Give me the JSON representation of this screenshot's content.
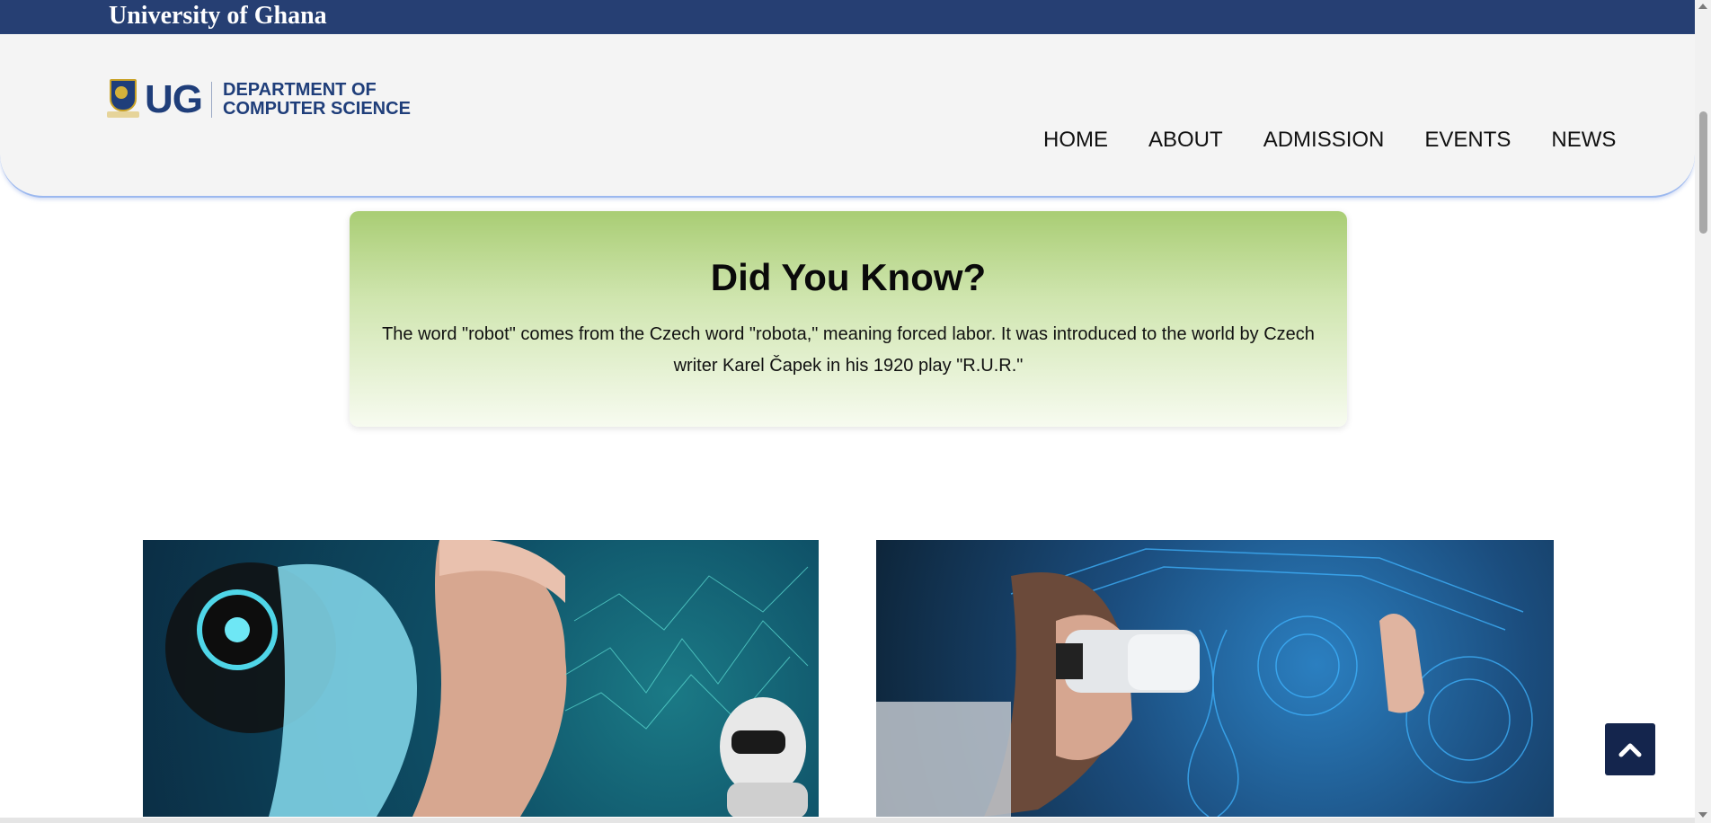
{
  "topbar": {
    "title": "University of Ghana"
  },
  "logo": {
    "short": "UG",
    "dept_line1": "DEPARTMENT OF",
    "dept_line2": "COMPUTER SCIENCE"
  },
  "nav": {
    "items": [
      {
        "label": "HOME"
      },
      {
        "label": "ABOUT"
      },
      {
        "label": "ADMISSION"
      },
      {
        "label": "EVENTS"
      },
      {
        "label": "NEWS"
      }
    ]
  },
  "did_you_know": {
    "heading": "Did You Know?",
    "text": "The word \"robot\" comes from the Czech word \"robota,\" meaning forced labor. It was introduced to the world by Czech writer Karel Čapek in his 1920 play \"R.U.R.\""
  },
  "images": {
    "left_icon": "ai-humanoid-image",
    "right_icon": "vr-headset-image"
  },
  "scroll_top": {
    "icon": "chevron-up-icon"
  },
  "colors": {
    "topbar": "#263f73",
    "brand_blue": "#1f3e7a",
    "card_green": "#a9cd74",
    "scroll_button": "#14254d"
  }
}
